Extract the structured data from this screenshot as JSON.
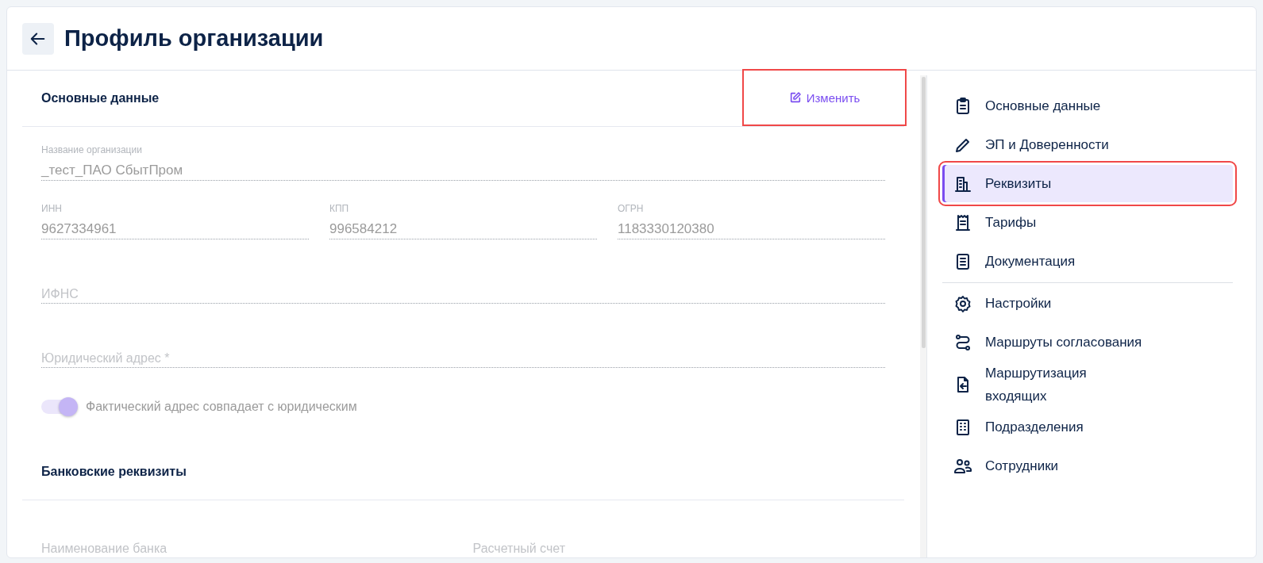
{
  "header": {
    "title": "Профиль организации"
  },
  "main_section": {
    "title": "Основные данные",
    "edit_button": {
      "label": "Изменить",
      "highlighted": true
    }
  },
  "fields": [
    {
      "label": "Название организации",
      "value": "_тест_ПАО СбытПром",
      "disabled": true
    },
    {
      "label": "ИНН",
      "value": "9627334961",
      "disabled": true
    },
    {
      "label": "КПП",
      "value": "996584212",
      "disabled": true
    },
    {
      "label": "ОГРН",
      "value": "1183330120380",
      "disabled": true
    },
    {
      "placeholder": "ИФНС",
      "disabled": true
    },
    {
      "placeholder": "Юридический адрес *",
      "disabled": true
    }
  ],
  "address_toggle": {
    "label": "Фактический адрес совпадает с юридическим",
    "on": true,
    "disabled": true
  },
  "bank_section": {
    "title": "Банковские реквизиты",
    "fields": [
      {
        "placeholder": "Наименование банка",
        "disabled": true
      },
      {
        "placeholder": "Расчетный счет",
        "disabled": true
      }
    ]
  },
  "nav": {
    "groups": [
      [
        {
          "label": "Основные данные",
          "selected": false,
          "highlighted": false
        },
        {
          "label": "ЭП и Доверенности",
          "selected": false,
          "highlighted": false
        },
        {
          "label": "Реквизиты",
          "selected": true,
          "highlighted": true
        },
        {
          "label": "Тарифы",
          "selected": false,
          "highlighted": false
        },
        {
          "label": "Документация",
          "selected": false,
          "highlighted": false
        }
      ],
      [
        {
          "label": "Настройки",
          "selected": false,
          "highlighted": false
        },
        {
          "label": "Маршруты согласования",
          "selected": false,
          "highlighted": false
        },
        {
          "label": "Маршрутизация входящих",
          "selected": false,
          "highlighted": false
        },
        {
          "label": "Подразделения",
          "selected": false,
          "highlighted": false
        },
        {
          "label": "Сотрудники",
          "selected": false,
          "highlighted": false
        }
      ]
    ]
  }
}
